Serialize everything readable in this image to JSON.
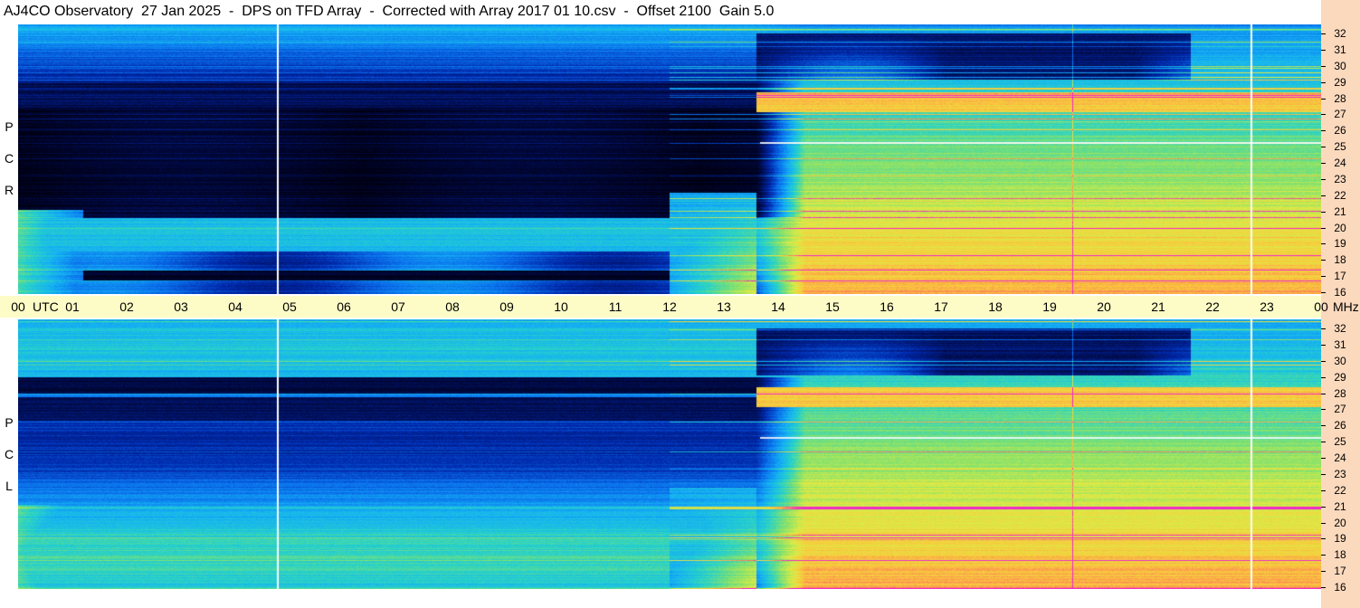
{
  "title": "AJ4CO Observatory  27 Jan 2025  -  DPS on TFD Array  -  Corrected with Array 2017 01 10.csv  -  Offset 2100  Gain 5.0",
  "chart_data": {
    "type": "heatmap",
    "panels": [
      {
        "name": "RCP",
        "label_letters": [
          "P",
          "C",
          "R"
        ]
      },
      {
        "name": "LCP",
        "label_letters": [
          "P",
          "C",
          "L"
        ]
      }
    ],
    "x_axis": {
      "unit": "UTC",
      "range": [
        0,
        24
      ],
      "tick_labels": [
        "00",
        "01",
        "02",
        "03",
        "04",
        "05",
        "06",
        "07",
        "08",
        "09",
        "10",
        "11",
        "12",
        "13",
        "14",
        "15",
        "16",
        "17",
        "18",
        "19",
        "20",
        "21",
        "22",
        "23",
        "00"
      ]
    },
    "y_axis": {
      "unit": "MHz",
      "range": [
        16,
        32
      ],
      "tick_labels": [
        "32",
        "31",
        "30",
        "29",
        "28",
        "27",
        "26",
        "25",
        "24",
        "23",
        "22",
        "21",
        "20",
        "19",
        "18",
        "17",
        "16"
      ]
    },
    "colors": {
      "background_right": "#fbd9bd",
      "utc_band": "#fdfbc6"
    }
  }
}
